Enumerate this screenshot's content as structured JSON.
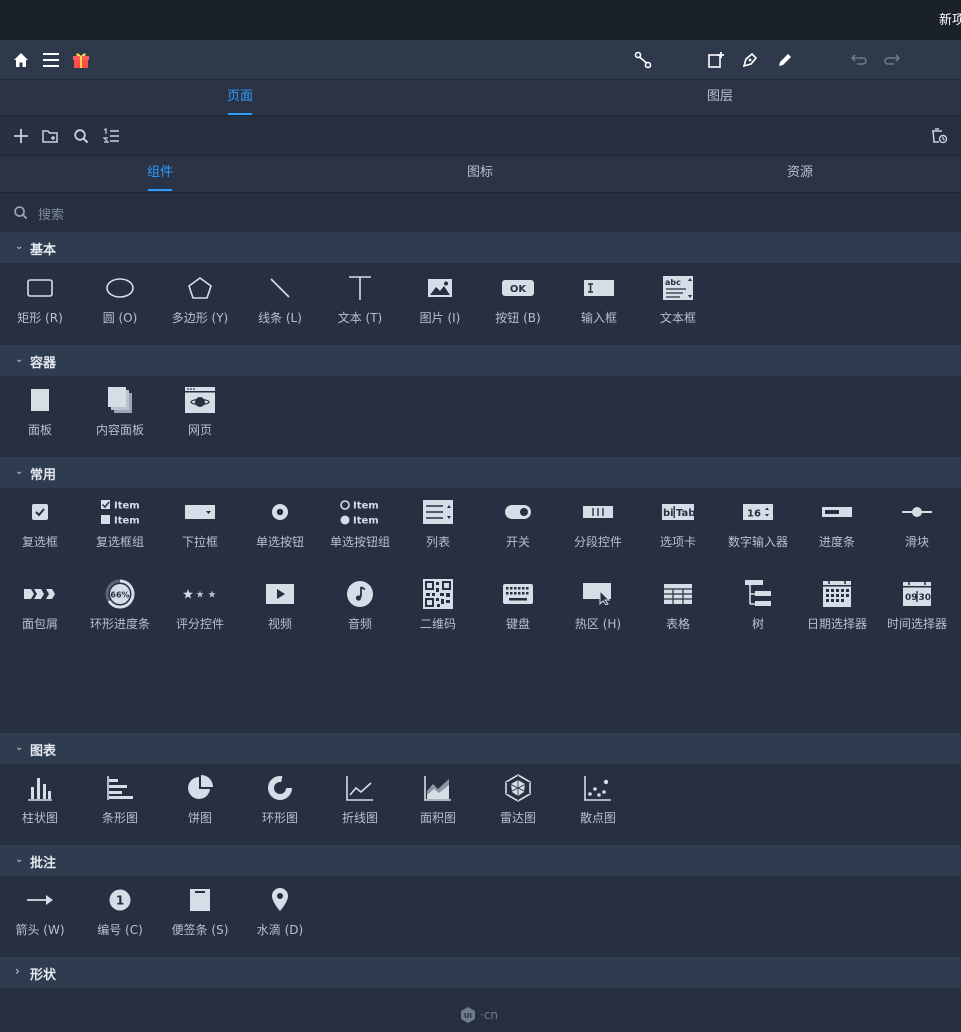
{
  "titlebar": {
    "title": "新项目"
  },
  "toolbar": {
    "left_icons": [
      "home-icon",
      "menu-icon",
      "gift-icon"
    ],
    "right_icons": [
      "flow-icon",
      "add-page-icon",
      "pen-icon",
      "pencil-icon",
      "undo-icon",
      "redo-icon"
    ]
  },
  "main_tabs": [
    {
      "label": "页面",
      "active": true
    },
    {
      "label": "图层",
      "active": false
    }
  ],
  "sub_tabs": [
    {
      "label": "组件",
      "active": true
    },
    {
      "label": "图标",
      "active": false
    },
    {
      "label": "资源",
      "active": false
    }
  ],
  "search": {
    "placeholder": "搜索"
  },
  "sections": {
    "basic": {
      "label": "基本",
      "items": [
        "矩形 (R)",
        "圆 (O)",
        "多边形 (Y)",
        "线条 (L)",
        "文本 (T)",
        "图片 (I)",
        "按钮 (B)",
        "输入框",
        "文本框"
      ]
    },
    "container": {
      "label": "容器",
      "items": [
        "面板",
        "内容面板",
        "网页"
      ]
    },
    "common": {
      "label": "常用",
      "row1": [
        "复选框",
        "复选框组",
        "下拉框",
        "单选按钮",
        "单选按钮组",
        "列表",
        "开关",
        "分段控件",
        "选项卡",
        "数字输入器",
        "进度条",
        "滑块"
      ],
      "row2": [
        "面包屑",
        "环形进度条",
        "评分控件",
        "视频",
        "音频",
        "二维码",
        "键盘",
        "热区 (H)",
        "表格",
        "树",
        "日期选择器",
        "时间选择器"
      ]
    },
    "charts": {
      "label": "图表",
      "items": [
        "柱状图",
        "条形图",
        "饼图",
        "环形图",
        "折线图",
        "面积图",
        "雷达图",
        "散点图"
      ]
    },
    "annotation": {
      "label": "批注",
      "items": [
        "箭头 (W)",
        "编号 (C)",
        "便签条 (S)",
        "水滴 (D)"
      ]
    },
    "shape": {
      "label": "形状"
    }
  },
  "icon_text": {
    "ok": "OK",
    "abc": "abc",
    "item": "Item",
    "bitab": "bi",
    "tab": "Tab",
    "num16": "16",
    "pct66": "66%",
    "time_a": "09",
    "time_b": "30",
    "marker_1": "1"
  },
  "watermark": {
    "text": "·cn",
    "logo": "UI"
  },
  "colors": {
    "accent": "#2e9bff",
    "background": "#263040",
    "header": "#2f3b4e"
  }
}
